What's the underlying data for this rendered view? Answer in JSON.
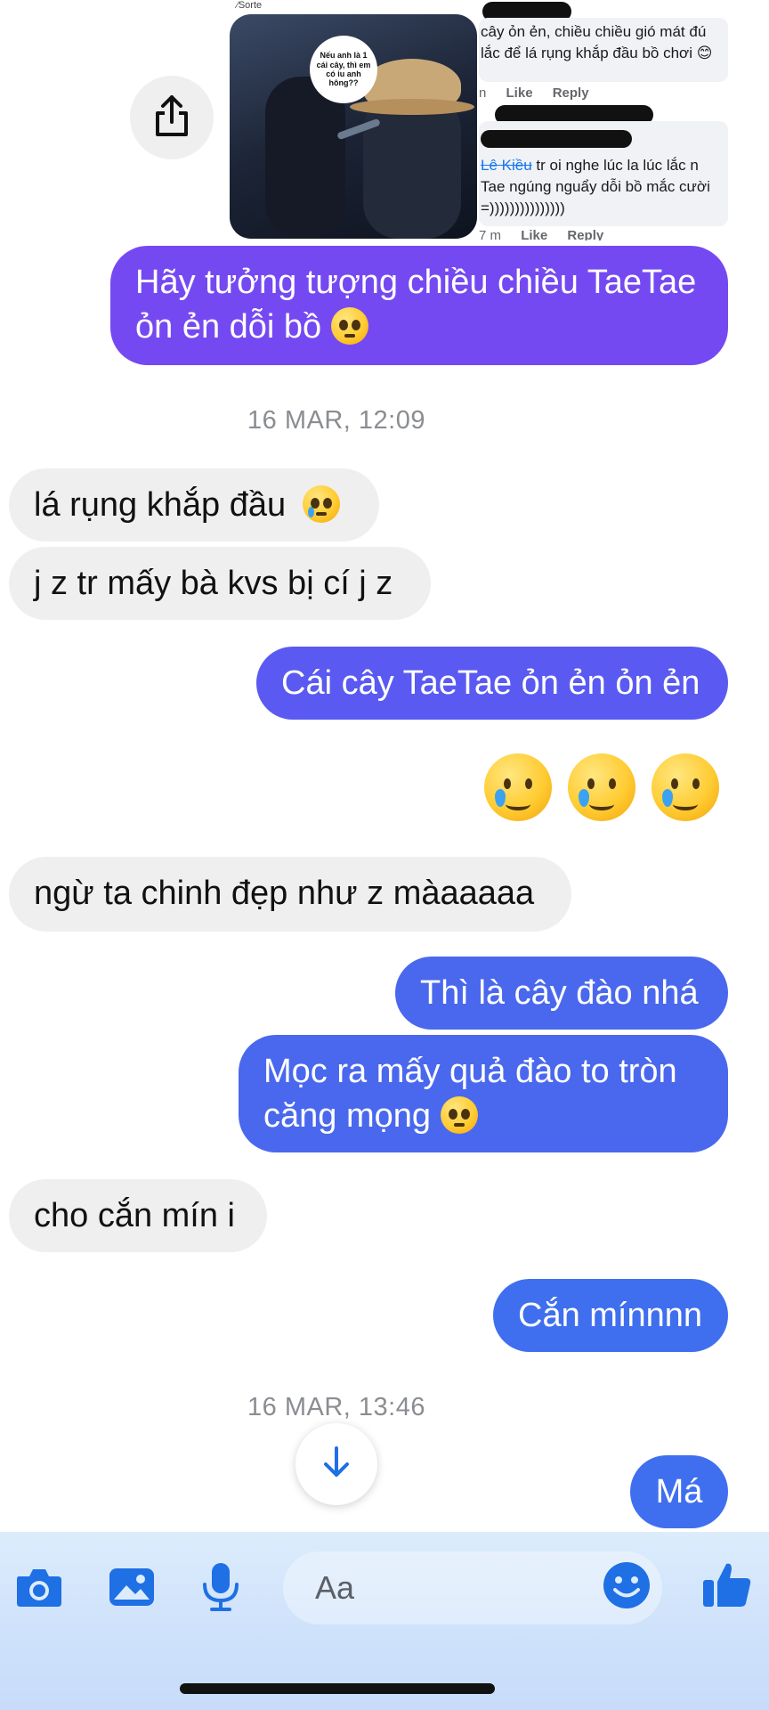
{
  "colors": {
    "outgoing_purple": "#7549f2",
    "outgoing_violet": "#5a5af2",
    "outgoing_blue": "#4a68ee",
    "outgoing_blue_deep": "#3f6fef",
    "incoming_gray": "#efefef",
    "accent_icon": "#1f6fe5",
    "composer_bg": "#d6e8fb"
  },
  "shared_post": {
    "source_label": "Sorte",
    "speech_bubble_text": "Nếu anh là 1 cái cây, thì em có iu anh hông??",
    "comment_1": {
      "line_1": "cây ỏn ẻn, chiều chiều gió mát đú",
      "line_2": "lắc để lá rụng khắp đầu bồ chơi 😊",
      "time": "n",
      "like_label": "Like",
      "reply_label": "Reply"
    },
    "comment_2": {
      "author": "Lê Kiều",
      "line_1": " tr oi nghe lúc la lúc lắc n",
      "line_2": "Tae ngúng nguẩy dỗi bồ mắc cười",
      "line_3": "=)))))))))))))))",
      "time": "7 m",
      "like_label": "Like",
      "reply_label": "Reply"
    },
    "share_icon": "share-icon"
  },
  "messages": {
    "m1": "Hãy tưởng tượng chiều chiều TaeTae",
    "m1_line2": "ỏn ẻn dỗi bồ",
    "timestamp_1": "16 MAR, 12:09",
    "m2": "lá rụng khắp đầu",
    "m3": "j z tr mấy bà kvs bị cí j z",
    "m4": "Cái cây TaeTae ỏn ẻn ỏn ẻn",
    "m5_emoji": "🥲🥲🥲",
    "m6": "ngừ ta chinh đẹp như z màaaaaa",
    "m7": "Thì là cây đào nhá",
    "m8_line1": "Mọc ra mấy quả đào to tròn",
    "m8_line2": "căng mọng",
    "m9": "cho cắn mín i",
    "m10": "Cắn mínnnn",
    "timestamp_2": "16 MAR, 13:46",
    "m11": "Má"
  },
  "composer": {
    "placeholder": "Aa",
    "icons": [
      "camera-icon",
      "image-icon",
      "microphone-icon",
      "emoji-icon",
      "thumbs-up-icon"
    ]
  }
}
